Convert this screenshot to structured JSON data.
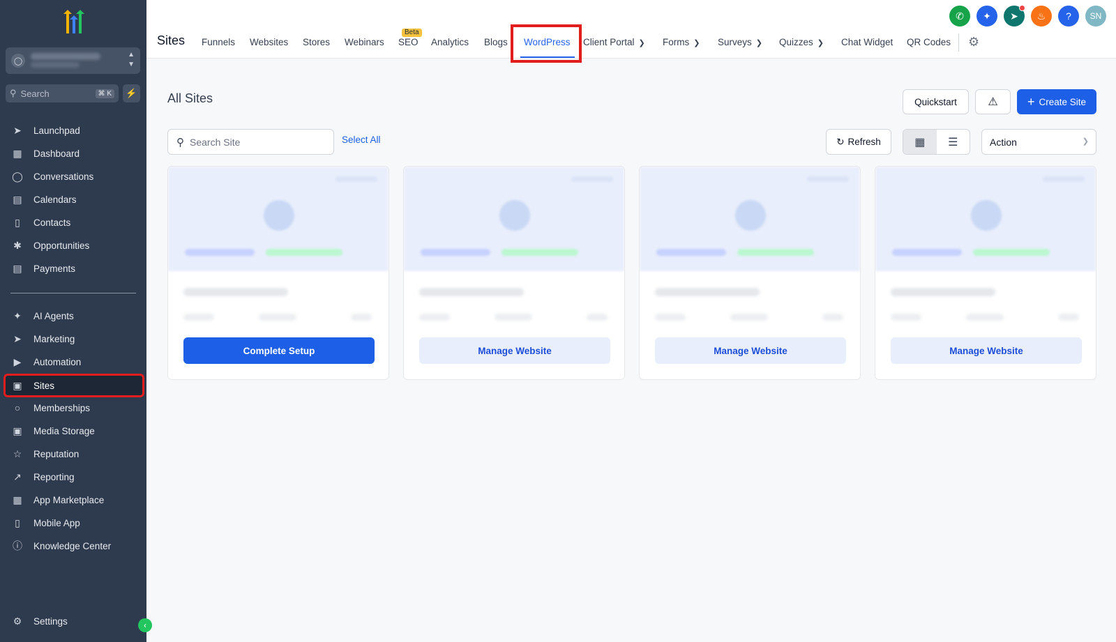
{
  "sidebar": {
    "search": {
      "label": "Search",
      "shortcut": "⌘ K"
    },
    "items": [
      {
        "label": "Launchpad",
        "icon": "launchpad-icon"
      },
      {
        "label": "Dashboard",
        "icon": "dashboard-icon"
      },
      {
        "label": "Conversations",
        "icon": "conversations-icon"
      },
      {
        "label": "Calendars",
        "icon": "calendar-icon"
      },
      {
        "label": "Contacts",
        "icon": "contacts-icon"
      },
      {
        "label": "Opportunities",
        "icon": "opportunities-icon"
      },
      {
        "label": "Payments",
        "icon": "payments-icon"
      }
    ],
    "items2": [
      {
        "label": "AI Agents",
        "icon": "ai-agents-icon"
      },
      {
        "label": "Marketing",
        "icon": "marketing-icon"
      },
      {
        "label": "Automation",
        "icon": "automation-icon"
      },
      {
        "label": "Sites",
        "icon": "sites-icon",
        "active": true
      },
      {
        "label": "Memberships",
        "icon": "memberships-icon"
      },
      {
        "label": "Media Storage",
        "icon": "media-storage-icon"
      },
      {
        "label": "Reputation",
        "icon": "star-icon"
      },
      {
        "label": "Reporting",
        "icon": "reporting-icon"
      },
      {
        "label": "App Marketplace",
        "icon": "app-marketplace-icon"
      },
      {
        "label": "Mobile App",
        "icon": "mobile-icon"
      },
      {
        "label": "Knowledge Center",
        "icon": "info-icon"
      }
    ],
    "settings": "Settings"
  },
  "header": {
    "title": "Sites",
    "tabs": [
      "Funnels",
      "Websites",
      "Stores",
      "Webinars",
      "SEO",
      "Analytics",
      "Blogs",
      "WordPress",
      "Client Portal",
      "Forms",
      "Surveys",
      "Quizzes",
      "Chat Widget",
      "QR Codes"
    ],
    "seo_badge": "Beta",
    "avatar_initials": "SN",
    "colors": {
      "phone": "#16a34a",
      "ai": "#2563eb",
      "announce": "#0f766e",
      "bell": "#f97316",
      "help": "#2563eb",
      "avatar": "#7fb8c4"
    }
  },
  "main": {
    "title": "All Sites",
    "quickstart": "Quickstart",
    "create_site": "Create Site",
    "search_placeholder": "Search Site",
    "select_all": "Select All",
    "refresh": "Refresh",
    "action": "Action",
    "cards": [
      {
        "button": "Complete Setup"
      },
      {
        "button": "Manage Website"
      },
      {
        "button": "Manage Website"
      },
      {
        "button": "Manage Website"
      }
    ]
  }
}
